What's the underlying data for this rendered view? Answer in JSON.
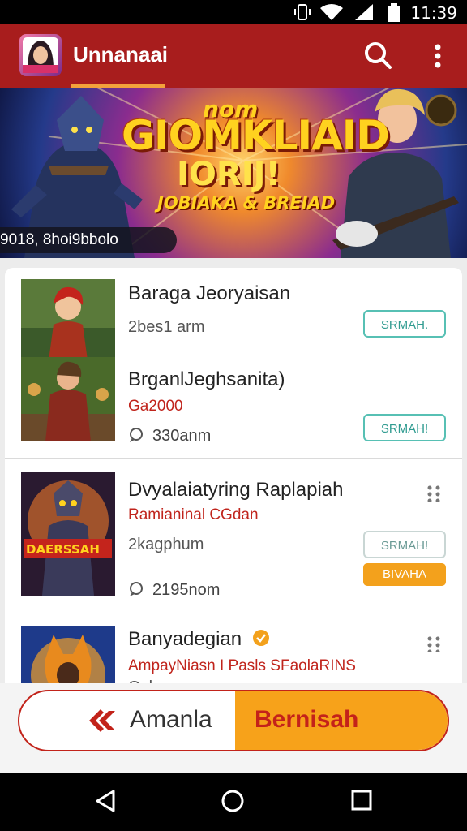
{
  "status_bar": {
    "time": "11:39"
  },
  "app_bar": {
    "title": "Unnanaai"
  },
  "banner": {
    "kicker": "nom",
    "title": "GIOMKLIAID",
    "subtitle": "IORIJ!",
    "tagline": "JOBIAKA & BREIAD",
    "caption": "9018, 8hoi9bbolo"
  },
  "items": [
    {
      "title": "Baraga Jeoryaisan",
      "meta": "2bes1 arm",
      "button": "SRMAH."
    },
    {
      "title": "BrganlJeghsanita)",
      "red": "Gа2000",
      "count": "330anm",
      "button": "SRMAH!"
    },
    {
      "title": "Dvyalaiatyring Raplapiah",
      "red": "Ramianinal CGdan",
      "meta": "2kagphum",
      "count": "2195nom",
      "button": "SRMAH!",
      "button2": "BIVAHA",
      "thumb_label": "DAERSSAH"
    },
    {
      "title": "Banyadegian",
      "red": "AmpayNiasn I Pasls SFaolaRINS",
      "meta": "Cabaaoaram"
    }
  ],
  "cta": {
    "left_label": "Amanla",
    "right_label": "Bernisah"
  },
  "colors": {
    "brand_red": "#a81d1d",
    "accent_orange": "#f7a21a",
    "teal": "#57c0b4"
  }
}
